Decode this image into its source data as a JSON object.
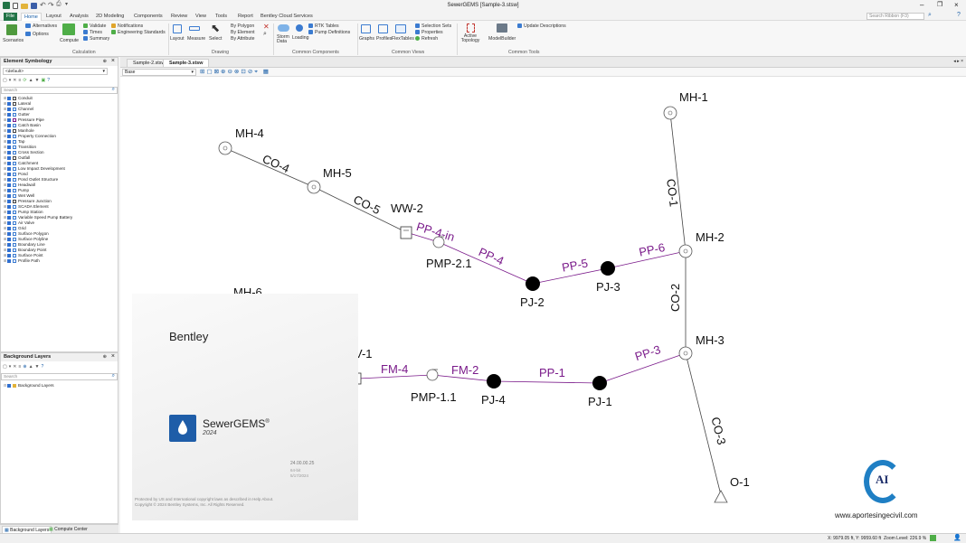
{
  "window": {
    "title": "SewerGEMS [Sample-3.stsw]"
  },
  "ribbon_tabs": [
    "File",
    "Home",
    "Layout",
    "Analysis",
    "2D Modeling",
    "Components",
    "Review",
    "View",
    "Tools",
    "Report",
    "Bentley Cloud Services"
  ],
  "search_ribbon_placeholder": "Search Ribbon (F3)",
  "ribbon": {
    "scenarios": "Scenarios",
    "alternatives": "Alternatives",
    "options": "Options",
    "compute": "Compute",
    "validate": "Validate",
    "times": "Times",
    "summary": "Summary",
    "notifications": "Notifications",
    "engineering_standards": "Engineering Standards",
    "layout": "Layout",
    "measure": "Measure",
    "select": "Select",
    "by_polygon": "By Polygon",
    "by_element": "By Element",
    "by_attribute": "By Attribute",
    "storm_data": "Storm Data",
    "loading": "Loading",
    "rtk_tables": "RTK Tables",
    "pump_definitions": "Pump Definitions",
    "graphs": "Graphs",
    "profiles": "Profiles",
    "flextables": "FlexTables",
    "selection_sets": "Selection Sets",
    "properties": "Properties",
    "refresh": "Refresh",
    "active_topology": "Active Topology",
    "modelbuilder": "ModelBuilder",
    "update_descriptions": "Update Descriptions",
    "groups": [
      "Calculation",
      "Drawing",
      "Common Components",
      "Common Views",
      "Common Tools"
    ]
  },
  "symbology_panel": {
    "title": "Element Symbology",
    "dropdown": "<default>",
    "search_placeholder": "Search",
    "items": [
      "Conduit",
      "Lateral",
      "Channel",
      "Gutter",
      "Pressure Pipe",
      "Catch Basin",
      "Manhole",
      "Property Connection",
      "Tap",
      "Transition",
      "Cross Section",
      "Outfall",
      "Catchment",
      "Low Impact Development",
      "Pond",
      "Pond Outlet Structure",
      "Headwall",
      "Pump",
      "Wet Well",
      "Pressure Junction",
      "SCADA Element",
      "Pump Station",
      "Variable Speed Pump Battery",
      "Air Valve",
      "Grid",
      "Surface Polygon",
      "Surface Polyline",
      "Boundary Line",
      "Boundary Point",
      "Surface Point",
      "Profile Path"
    ]
  },
  "background_panel": {
    "title": "Background Layers",
    "search_placeholder": "Search",
    "item": "Background Layers"
  },
  "bottom_tabs": [
    "Background Layers",
    "Compute Center"
  ],
  "doc_tabs": [
    "Sample-2.stsw",
    "Sample-3.stsw"
  ],
  "view_dropdown": "Base",
  "network": {
    "nodes": {
      "MH-1": "MH-1",
      "MH-2": "MH-2",
      "MH-3": "MH-3",
      "MH-4": "MH-4",
      "MH-5": "MH-5",
      "MH-6": "MH-6",
      "WW-2": "WW-2",
      "PMP-2.1": "PMP-2.1",
      "PMP-1.1": "PMP-1.1",
      "PJ-1": "PJ-1",
      "PJ-2": "PJ-2",
      "PJ-3": "PJ-3",
      "PJ-4": "PJ-4",
      "O-1": "O-1",
      "W-1": "V-1"
    },
    "conduits": {
      "CO-1": "CO-1",
      "CO-2": "CO-2",
      "CO-3": "CO-3",
      "CO-4": "CO-4",
      "CO-5": "CO-5"
    },
    "pressure_pipes": {
      "PP-1": "PP-1",
      "PP-3": "PP-3",
      "PP-4": "PP-4",
      "PP-4-in": "PP-4-in",
      "PP-5": "PP-5",
      "PP-6": "PP-6",
      "FM-2": "FM-2",
      "FM-4": "FM-4"
    }
  },
  "splash": {
    "brand": "Bentley",
    "product": "SewerGEMS",
    "registered": "®",
    "year": "2024",
    "version": "24.00.00.25",
    "version_sub1": "64-bit",
    "version_sub2": "5/17/2024",
    "copyright1": "Protected by US and International copyright laws as described in Help About.",
    "copyright2": "Copyright © 2024 Bentley Systems, Inc. All Rights Reserved."
  },
  "watermark": {
    "url": "www.aportesingecivil.com",
    "logo_letters": "AI"
  },
  "status_bar": {
    "coords": "X: 9979.05 ft, Y: 9959.60 ft",
    "zoom": "Zoom Level: 226.9 %"
  },
  "colors": {
    "accent": "#217346",
    "pressure": "#7a1a8a",
    "blue": "#2f6fd0"
  }
}
